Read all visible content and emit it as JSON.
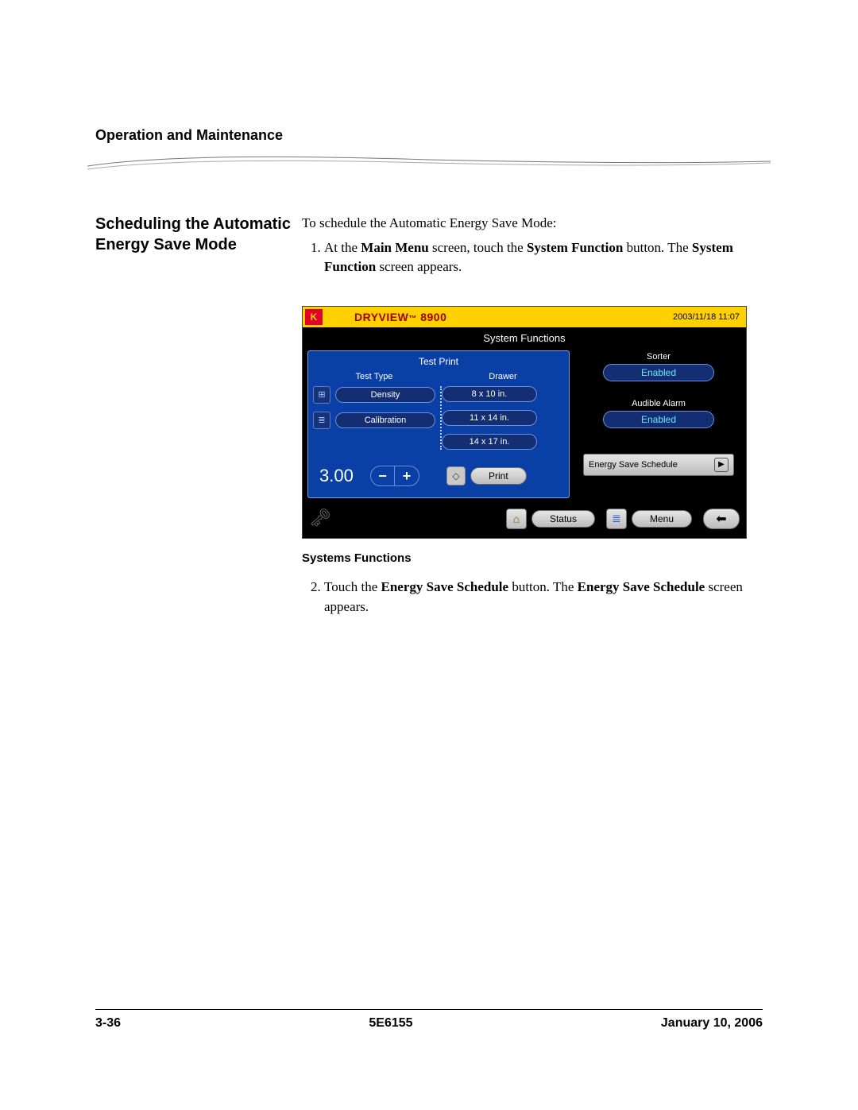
{
  "running_head": "Operation and Maintenance",
  "side_heading": "Scheduling the Automatic Energy Save Mode",
  "intro": "To schedule the Automatic Energy Save Mode:",
  "step1_pre": "At the ",
  "step1_b1": "Main Menu",
  "step1_mid1": " screen, touch the ",
  "step1_b2": "System Function",
  "step1_mid2": " button. The ",
  "step1_b3": "System Function",
  "step1_post": " screen appears.",
  "caption": "Systems Functions",
  "step2_pre": "Touch the ",
  "step2_b1": "Energy Save Schedule",
  "step2_mid": " button. The ",
  "step2_b2": "Energy Save Schedule",
  "step2_post": " screen appears.",
  "footer": {
    "left": "3-36",
    "center": "5E6155",
    "right": "January 10, 2006"
  },
  "device": {
    "brand_sc": "DryView",
    "brand_model": " 8900",
    "timestamp": "2003/11/18 11:07",
    "title": "System Functions",
    "panel_head": "Test Print",
    "col1_head": "Test Type",
    "col2_head": "Drawer",
    "test_types": [
      "Density",
      "Calibration"
    ],
    "drawers": [
      "8 x 10 in.",
      "11 x 14 in.",
      "14 x 17 in."
    ],
    "value": "3.00",
    "minus": "−",
    "plus": "+",
    "print": "Print",
    "right": {
      "sorter_label": "Sorter",
      "sorter_value": "Enabled",
      "alarm_label": "Audible Alarm",
      "alarm_value": "Enabled",
      "energy_save": "Energy Save Schedule"
    },
    "foot": {
      "status": "Status",
      "menu": "Menu"
    }
  }
}
